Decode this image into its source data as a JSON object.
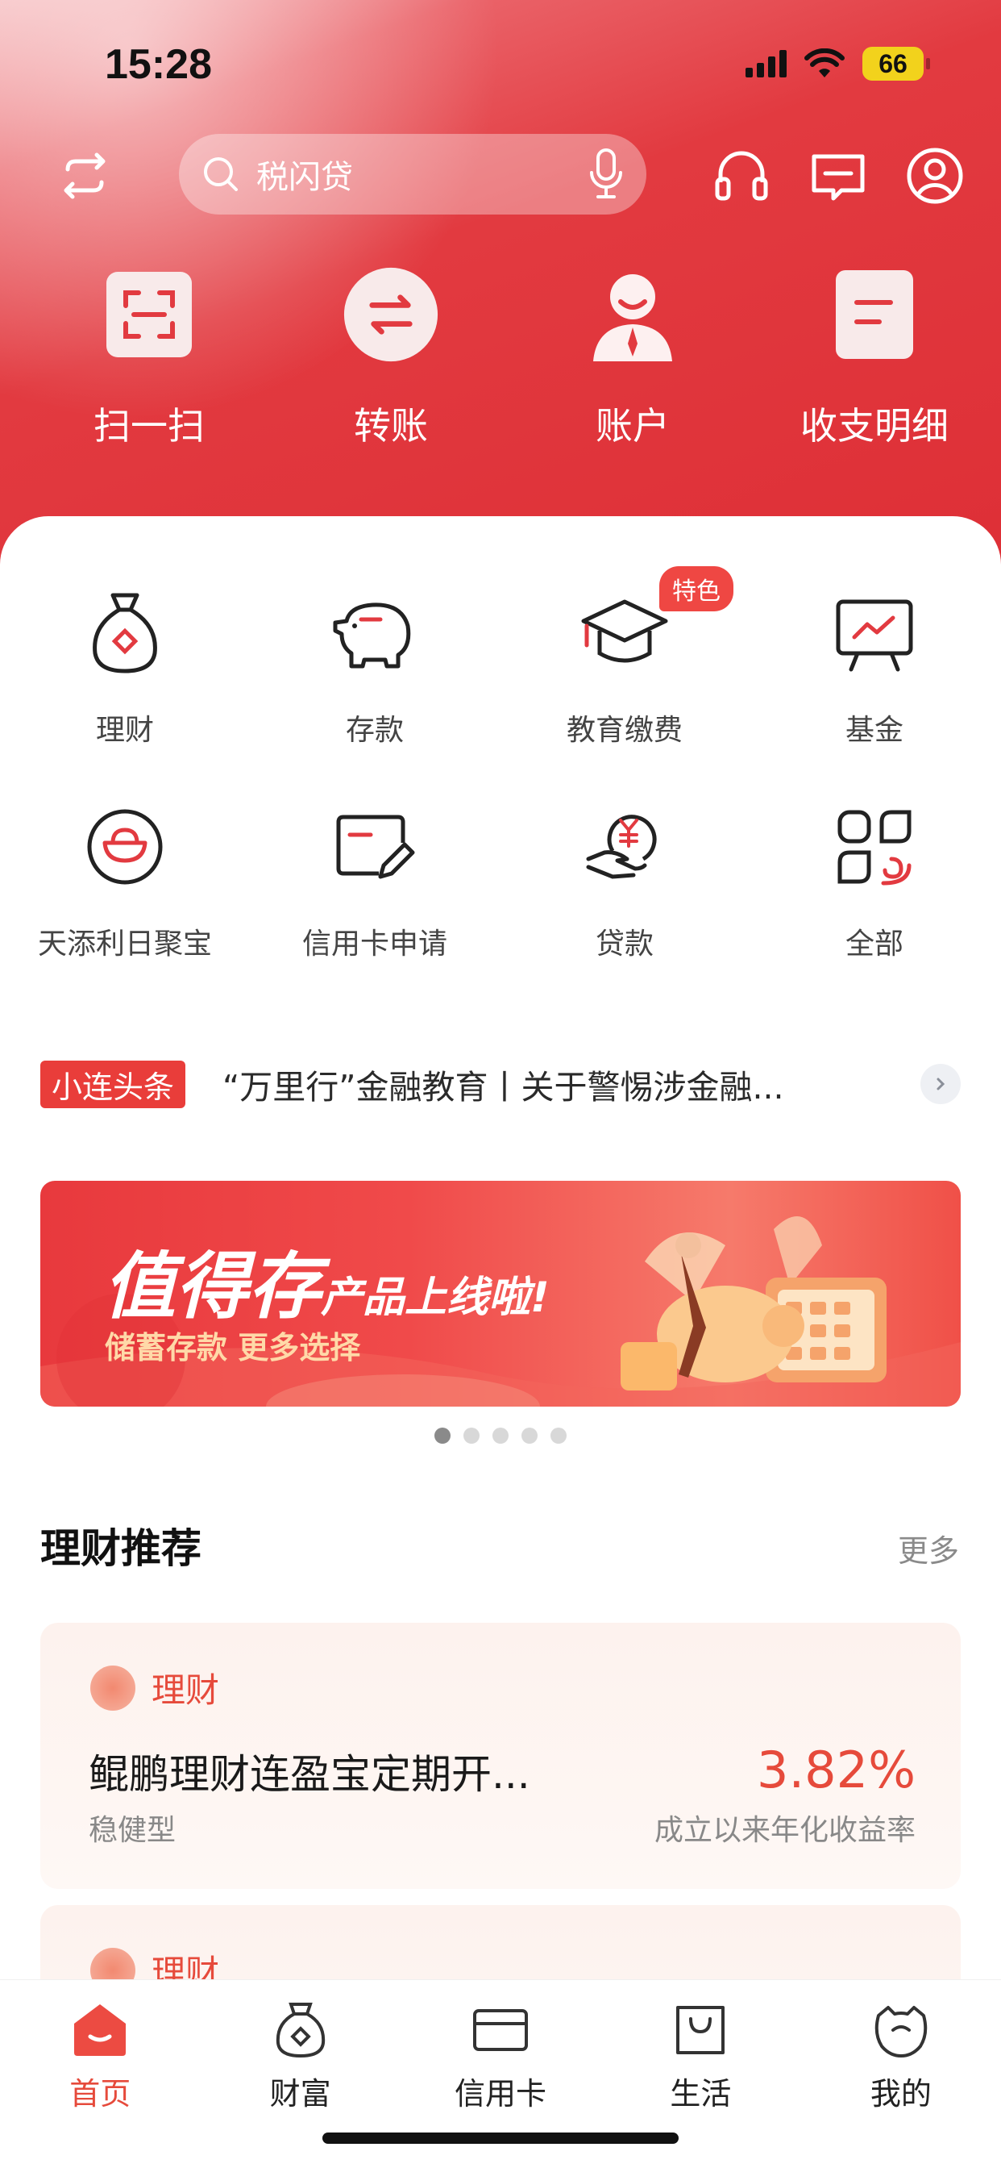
{
  "status_bar": {
    "time": "15:28",
    "battery": "66"
  },
  "header": {
    "search_placeholder": "税闪贷",
    "icons": [
      "switch-icon",
      "search-icon",
      "microphone-icon",
      "headset-icon",
      "message-icon",
      "user-icon"
    ]
  },
  "quick_actions": [
    {
      "label": "扫一扫",
      "icon": "scan-icon"
    },
    {
      "label": "转账",
      "icon": "transfer-icon"
    },
    {
      "label": "账户",
      "icon": "account-icon"
    },
    {
      "label": "收支明细",
      "icon": "statement-icon"
    }
  ],
  "services": [
    {
      "label": "理财",
      "icon": "money-bag-icon"
    },
    {
      "label": "存款",
      "icon": "piggy-bank-icon"
    },
    {
      "label": "教育缴费",
      "icon": "graduation-cap-icon",
      "badge": "特色"
    },
    {
      "label": "基金",
      "icon": "chart-board-icon"
    },
    {
      "label": "天添利日聚宝",
      "icon": "ingot-icon"
    },
    {
      "label": "信用卡申请",
      "icon": "card-pen-icon"
    },
    {
      "label": "贷款",
      "icon": "loan-hand-icon"
    },
    {
      "label": "全部",
      "icon": "grid-all-icon"
    }
  ],
  "news": {
    "tag": "小连头条",
    "text": "“万里行”金融教育丨关于警惕涉金融..."
  },
  "banner": {
    "title": "值得存",
    "title_suffix": "产品上线啦!",
    "subtitle": "储蓄存款  更多选择"
  },
  "carousel": {
    "count": 5,
    "active": 0
  },
  "recommend": {
    "title": "理财推荐",
    "more": "更多",
    "products": [
      {
        "category": "理财",
        "name": "鲲鹏理财连盈宝定期开...",
        "risk": "稳健型",
        "rate": "3.82%",
        "rate_desc": "成立以来年化收益率"
      },
      {
        "category": "理财"
      }
    ]
  },
  "tabbar": [
    {
      "label": "首页",
      "icon": "home-icon",
      "active": true
    },
    {
      "label": "财富",
      "icon": "wealth-bag-icon"
    },
    {
      "label": "信用卡",
      "icon": "credit-card-icon"
    },
    {
      "label": "生活",
      "icon": "shopping-bag-icon"
    },
    {
      "label": "我的",
      "icon": "profile-face-icon"
    }
  ],
  "colors": {
    "brand_red": "#e23a40",
    "accent": "#e64a3b"
  }
}
